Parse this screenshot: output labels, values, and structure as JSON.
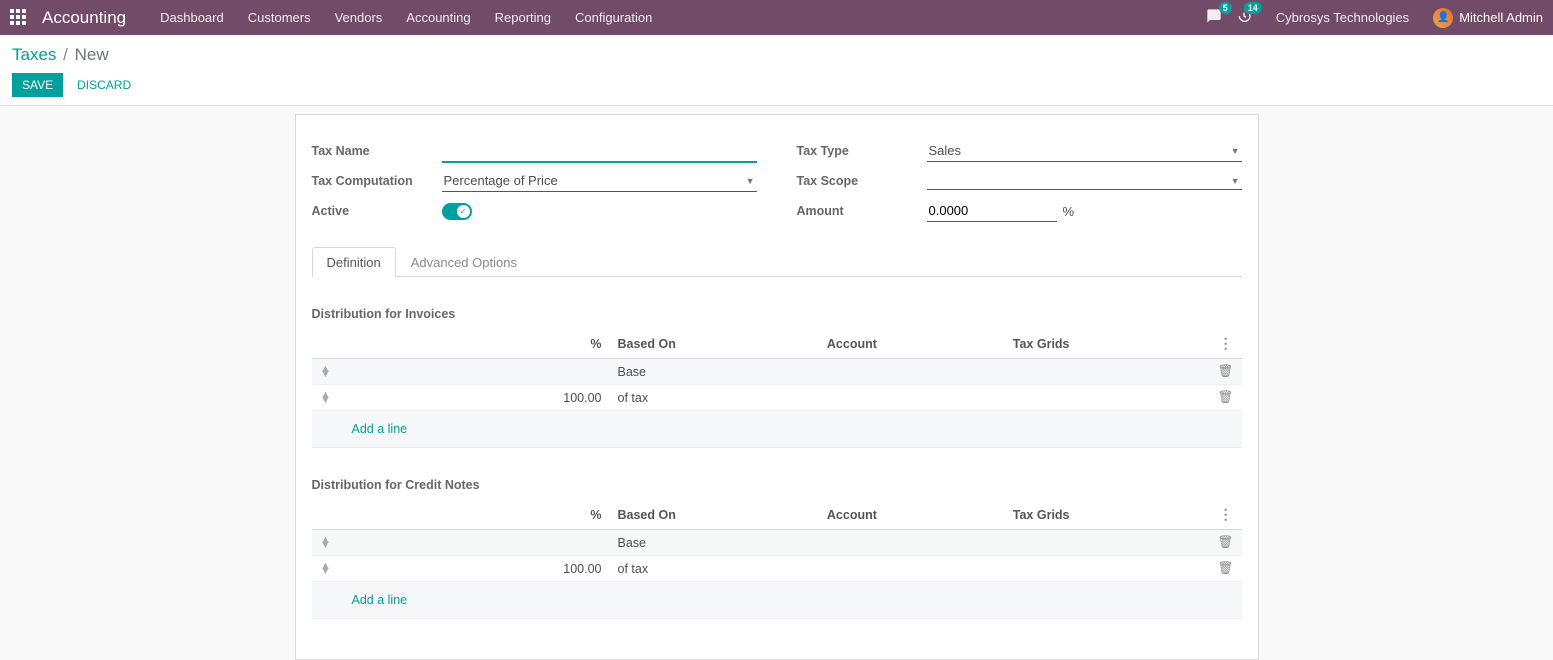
{
  "navbar": {
    "app_name": "Accounting",
    "menu": [
      "Dashboard",
      "Customers",
      "Vendors",
      "Accounting",
      "Reporting",
      "Configuration"
    ],
    "messages_badge": "5",
    "activities_badge": "14",
    "company": "Cybrosys Technologies",
    "user": "Mitchell Admin"
  },
  "breadcrumb": {
    "parent": "Taxes",
    "current": "New"
  },
  "buttons": {
    "save": "SAVE",
    "discard": "DISCARD"
  },
  "form": {
    "labels": {
      "tax_name": "Tax Name",
      "tax_computation": "Tax Computation",
      "active": "Active",
      "tax_type": "Tax Type",
      "tax_scope": "Tax Scope",
      "amount": "Amount"
    },
    "values": {
      "tax_name": "",
      "tax_computation": "Percentage of Price",
      "tax_type": "Sales",
      "tax_scope": "",
      "amount": "0.0000",
      "amount_unit": "%"
    }
  },
  "tabs": {
    "definition": "Definition",
    "advanced": "Advanced Options"
  },
  "tables": {
    "invoices_title": "Distribution for Invoices",
    "credit_title": "Distribution for Credit Notes",
    "headers": {
      "pct": "%",
      "based_on": "Based On",
      "account": "Account",
      "tax_grids": "Tax Grids"
    },
    "invoices_rows": [
      {
        "pct": "",
        "based_on": "Base"
      },
      {
        "pct": "100.00",
        "based_on": "of tax"
      }
    ],
    "credit_rows": [
      {
        "pct": "",
        "based_on": "Base"
      },
      {
        "pct": "100.00",
        "based_on": "of tax"
      }
    ],
    "add_line": "Add a line"
  }
}
